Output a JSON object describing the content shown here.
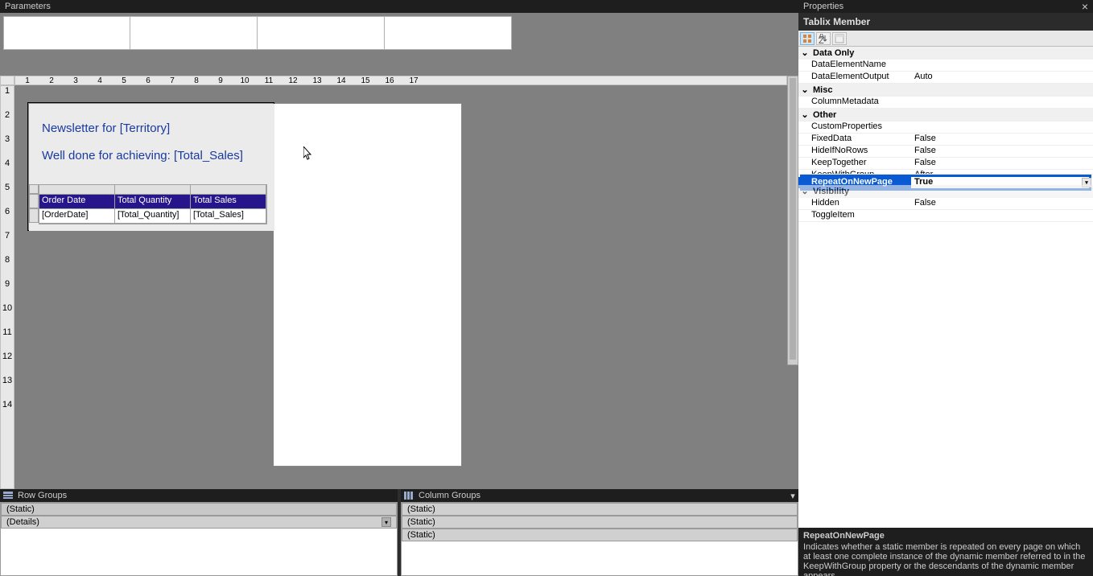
{
  "parameters": {
    "title": "Parameters"
  },
  "ruler": {
    "h": [
      "1",
      "2",
      "3",
      "4",
      "5",
      "6",
      "7",
      "8",
      "9",
      "10",
      "11",
      "12",
      "13",
      "14",
      "15",
      "16",
      "17"
    ],
    "v": [
      "1",
      "2",
      "3",
      "4",
      "5",
      "6",
      "7",
      "8",
      "9",
      "10",
      "11",
      "12",
      "13",
      "14"
    ]
  },
  "report": {
    "title1": "Newsletter for [Territory]",
    "title2": "Well done for achieving: [Total_Sales]",
    "table": {
      "headers": [
        "Order Date",
        "Total Quantity",
        "Total Sales"
      ],
      "row": [
        "[OrderDate]",
        "[Total_Quantity]",
        "[Total_Sales]"
      ]
    }
  },
  "groups": {
    "rowTitle": "Row Groups",
    "colTitle": "Column Groups",
    "rowItems": [
      "(Static)",
      "(Details)"
    ],
    "colItems": [
      "(Static)",
      "(Static)",
      "(Static)"
    ]
  },
  "properties": {
    "panelTitle": "Properties",
    "objectName": "Tablix Member",
    "closeGlyph": "×",
    "categories": [
      {
        "name": "Data Only",
        "rows": [
          {
            "n": "DataElementName",
            "v": ""
          },
          {
            "n": "DataElementOutput",
            "v": "Auto"
          }
        ]
      },
      {
        "name": "Misc",
        "rows": [
          {
            "n": "ColumnMetadata",
            "v": ""
          }
        ]
      },
      {
        "name": "Other",
        "rows": [
          {
            "n": "CustomProperties",
            "v": ""
          },
          {
            "n": "FixedData",
            "v": "False"
          },
          {
            "n": "HideIfNoRows",
            "v": "False"
          },
          {
            "n": "KeepTogether",
            "v": "False"
          },
          {
            "n": "KeepWithGroup",
            "v": "After",
            "cut": true
          },
          {
            "n": "RepeatOnNewPage",
            "v": "True",
            "highlight": true
          }
        ]
      },
      {
        "name": "Visibility",
        "cut": true,
        "rows": [
          {
            "n": "Hidden",
            "v": "False"
          },
          {
            "n": "ToggleItem",
            "v": ""
          }
        ]
      }
    ],
    "desc": {
      "title": "RepeatOnNewPage",
      "body": "Indicates whether a static member is repeated on every page on which at least one complete instance of the dynamic member referred to in the KeepWithGroup property or the descendants of the dynamic member appears."
    }
  }
}
